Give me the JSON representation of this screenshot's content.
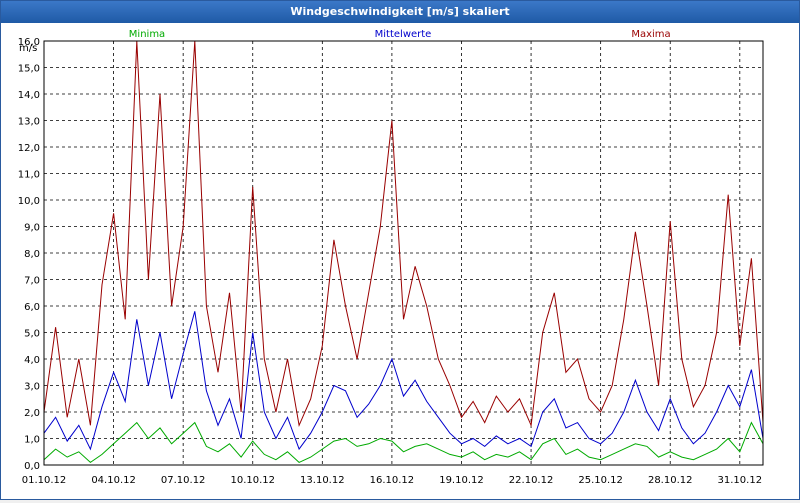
{
  "window": {
    "title": "Windgeschwindigkeit [m/s] skaliert"
  },
  "chart_data": {
    "type": "line",
    "title": "Windgeschwindigkeit [m/s] skaliert",
    "ylabel": "m/s",
    "xlabel": "",
    "ylim": [
      0,
      16
    ],
    "yticks": [
      "0,0",
      "1,0",
      "2,0",
      "3,0",
      "4,0",
      "5,0",
      "6,0",
      "7,0",
      "8,0",
      "9,0",
      "10,0",
      "11,0",
      "12,0",
      "13,0",
      "14,0",
      "15,0",
      "16,0"
    ],
    "xlim": [
      1,
      32
    ],
    "xticks": [
      {
        "x": 1,
        "label": "01.10.12"
      },
      {
        "x": 4,
        "label": "04.10.12"
      },
      {
        "x": 7,
        "label": "07.10.12"
      },
      {
        "x": 10,
        "label": "10.10.12"
      },
      {
        "x": 13,
        "label": "13.10.12"
      },
      {
        "x": 16,
        "label": "16.10.12"
      },
      {
        "x": 19,
        "label": "19.10.12"
      },
      {
        "x": 22,
        "label": "22.10.12"
      },
      {
        "x": 25,
        "label": "25.10.12"
      },
      {
        "x": 28,
        "label": "28.10.12"
      },
      {
        "x": 31,
        "label": "31.10.12"
      }
    ],
    "grid": true,
    "legend": [
      "Minima",
      "Mittelwerte",
      "Maxima"
    ],
    "colors": {
      "Minima": "#00aa00",
      "Mittelwerte": "#0000cc",
      "Maxima": "#990000"
    },
    "x": [
      1,
      1.5,
      2,
      2.5,
      3,
      3.5,
      4,
      4.5,
      5,
      5.5,
      6,
      6.5,
      7,
      7.5,
      8,
      8.5,
      9,
      9.5,
      10,
      10.5,
      11,
      11.5,
      12,
      12.5,
      13,
      13.5,
      14,
      14.5,
      15,
      15.5,
      16,
      16.5,
      17,
      17.5,
      18,
      18.5,
      19,
      19.5,
      20,
      20.5,
      21,
      21.5,
      22,
      22.5,
      23,
      23.5,
      24,
      24.5,
      25,
      25.5,
      26,
      26.5,
      27,
      27.5,
      28,
      28.5,
      29,
      29.5,
      30,
      30.5,
      31,
      31.5,
      32
    ],
    "series": [
      {
        "name": "Minima",
        "values": [
          0.2,
          0.6,
          0.3,
          0.5,
          0.1,
          0.4,
          0.8,
          1.2,
          1.6,
          1.0,
          1.4,
          0.8,
          1.2,
          1.6,
          0.7,
          0.5,
          0.8,
          0.3,
          0.9,
          0.4,
          0.2,
          0.5,
          0.1,
          0.3,
          0.6,
          0.9,
          1.0,
          0.7,
          0.8,
          1.0,
          0.9,
          0.5,
          0.7,
          0.8,
          0.6,
          0.4,
          0.3,
          0.5,
          0.2,
          0.4,
          0.3,
          0.5,
          0.2,
          0.8,
          1.0,
          0.4,
          0.6,
          0.3,
          0.2,
          0.4,
          0.6,
          0.8,
          0.7,
          0.3,
          0.5,
          0.3,
          0.2,
          0.4,
          0.6,
          1.0,
          0.5,
          1.6,
          0.8
        ]
      },
      {
        "name": "Mittelwerte",
        "values": [
          1.2,
          1.8,
          0.9,
          1.5,
          0.6,
          2.2,
          3.5,
          2.4,
          5.5,
          3.0,
          5.0,
          2.5,
          4.2,
          5.8,
          2.8,
          1.5,
          2.5,
          1.0,
          5.0,
          2.0,
          1.0,
          1.8,
          0.6,
          1.2,
          2.0,
          3.0,
          2.8,
          1.8,
          2.3,
          3.0,
          4.0,
          2.6,
          3.2,
          2.4,
          1.8,
          1.2,
          0.8,
          1.0,
          0.7,
          1.1,
          0.8,
          1.0,
          0.7,
          2.0,
          2.5,
          1.4,
          1.6,
          1.0,
          0.8,
          1.2,
          2.0,
          3.2,
          2.0,
          1.3,
          2.5,
          1.4,
          0.8,
          1.2,
          2.0,
          3.0,
          2.2,
          3.6,
          1.0
        ]
      },
      {
        "name": "Maxima",
        "values": [
          2.0,
          5.2,
          1.8,
          4.0,
          1.5,
          6.8,
          9.5,
          5.5,
          16.0,
          7.0,
          14.0,
          6.0,
          9.0,
          16.0,
          6.0,
          3.5,
          6.5,
          2.0,
          10.5,
          4.0,
          2.0,
          4.0,
          1.5,
          2.5,
          4.5,
          8.5,
          6.0,
          4.0,
          6.5,
          9.0,
          13.0,
          5.5,
          7.5,
          6.0,
          4.0,
          3.0,
          1.8,
          2.4,
          1.6,
          2.6,
          2.0,
          2.5,
          1.5,
          5.0,
          6.5,
          3.5,
          4.0,
          2.5,
          2.0,
          3.0,
          5.5,
          8.8,
          6.0,
          3.0,
          9.2,
          4.0,
          2.2,
          3.0,
          5.0,
          10.2,
          4.5,
          7.8,
          1.6
        ]
      }
    ]
  }
}
